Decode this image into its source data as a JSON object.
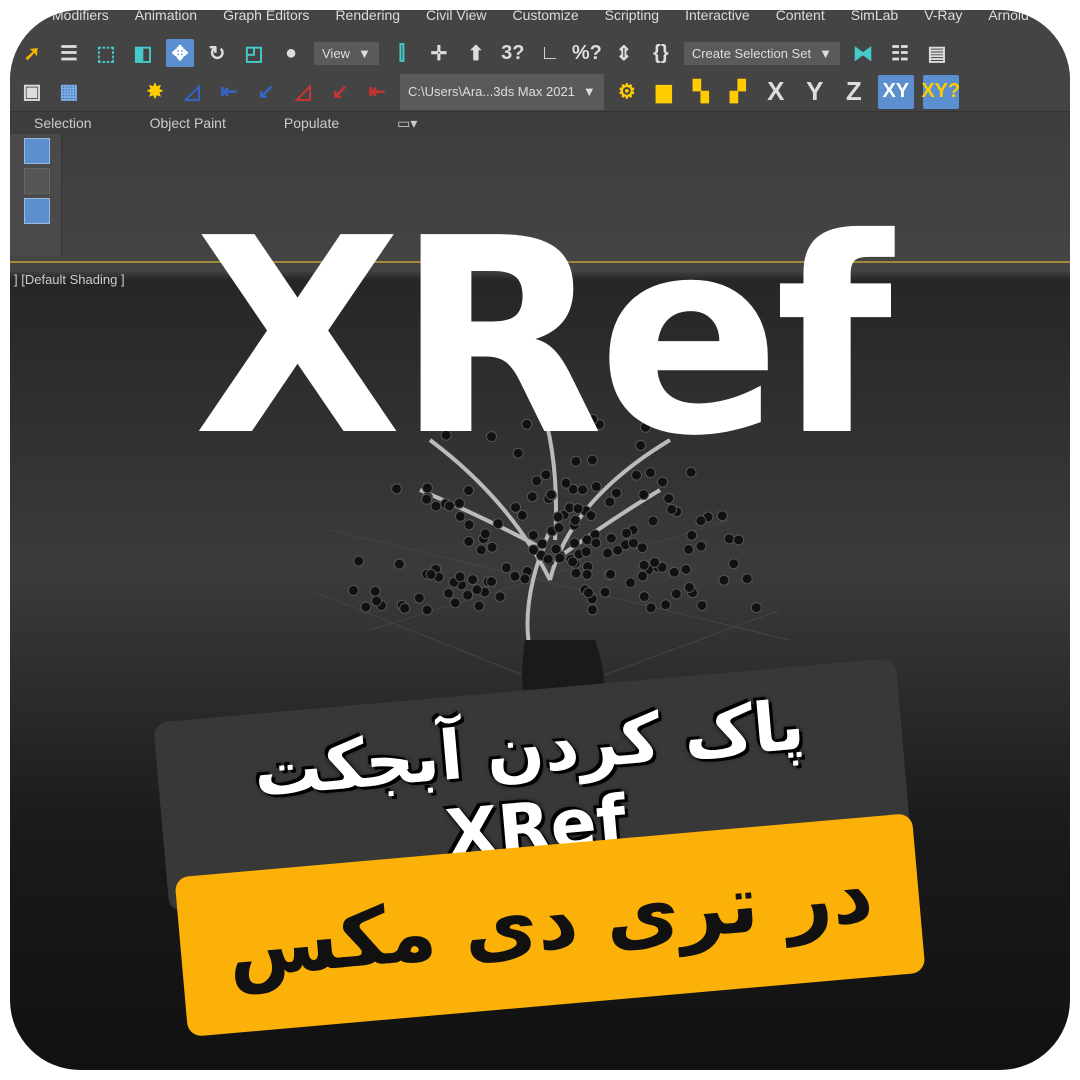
{
  "menu": [
    "Modifiers",
    "Animation",
    "Graph Editors",
    "Rendering",
    "Civil View",
    "Customize",
    "Scripting",
    "Interactive",
    "Content",
    "SimLab",
    "V-Ray",
    "Arnold"
  ],
  "toolbar": {
    "view_dropdown": "View",
    "selection_set": "Create Selection Set",
    "path_dropdown": "C:\\Users\\Ara...3ds Max 2021",
    "axes": [
      "X",
      "Y",
      "Z"
    ],
    "xy": "XY",
    "xy_snap": "XY?",
    "snap_labels": [
      "3?",
      "%?"
    ]
  },
  "ribbon": [
    "Selection",
    "Object Paint",
    "Populate"
  ],
  "viewport": {
    "label": "] [Default Shading ]"
  },
  "headline": "XRef",
  "caption_line1": "پاک کردن آبجکت XRef",
  "caption_line2": "در تری دی مکس",
  "colors": {
    "accent": "#fcb109",
    "selected": "#5b8fd0"
  },
  "arrow": "▼"
}
